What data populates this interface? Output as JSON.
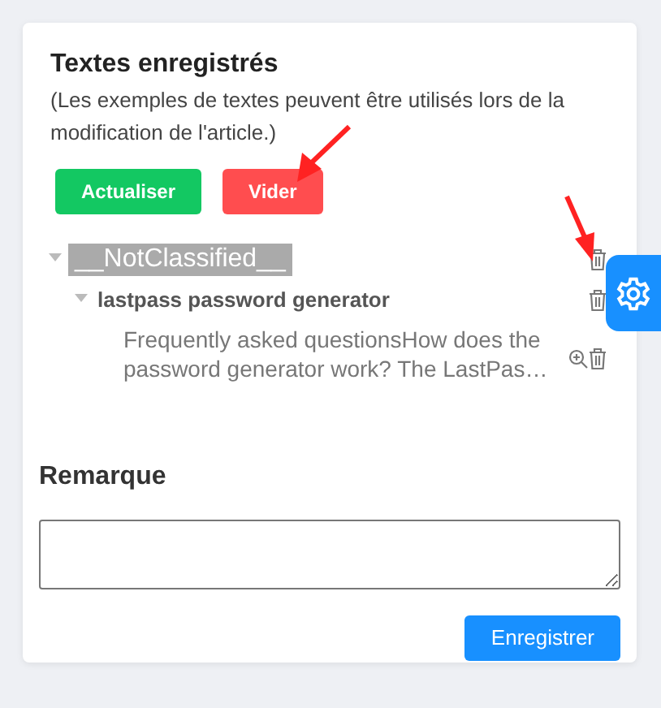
{
  "panel": {
    "title": "Textes enregistrés",
    "subtitle": "(Les exemples de textes peuvent être utilisés lors de la modification de l'article.)",
    "buttons": [
      {
        "label": "Actualiser",
        "kind": "success"
      },
      {
        "label": "Vider",
        "kind": "danger"
      }
    ],
    "tree": [
      {
        "label": "__NotClassified__",
        "kind": "category",
        "expanded": true,
        "selected": true,
        "children": [
          {
            "label": "lastpass password generator",
            "kind": "group",
            "expanded": true,
            "selected": false,
            "children": [
              {
                "label": "Frequently asked questionsHow does the password generator work? The LastPas…",
                "kind": "text",
                "selected": false
              }
            ]
          }
        ]
      }
    ]
  },
  "remark": {
    "label": "Remarque",
    "save_button": "Enregistrer"
  }
}
